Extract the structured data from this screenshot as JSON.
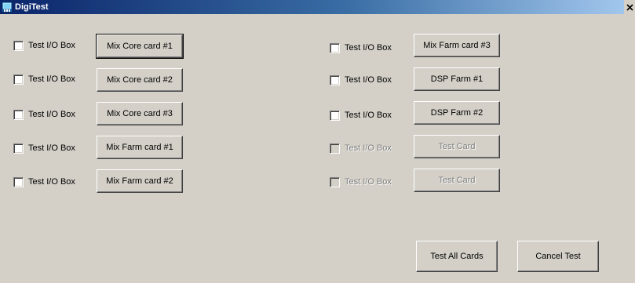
{
  "window": {
    "title": "DigiTest",
    "close_glyph": "✕"
  },
  "left_column": [
    {
      "checkbox_label": "Test I/O Box",
      "checked": false,
      "enabled": true,
      "button_label": "Mix Core card #1",
      "button_enabled": true
    },
    {
      "checkbox_label": "Test I/O Box",
      "checked": false,
      "enabled": true,
      "button_label": "Mix Core card #2",
      "button_enabled": true
    },
    {
      "checkbox_label": "Test I/O Box",
      "checked": false,
      "enabled": true,
      "button_label": "Mix Core card #3",
      "button_enabled": true
    },
    {
      "checkbox_label": "Test I/O Box",
      "checked": false,
      "enabled": true,
      "button_label": "Mix Farm card #1",
      "button_enabled": true
    },
    {
      "checkbox_label": "Test I/O Box",
      "checked": false,
      "enabled": true,
      "button_label": "Mix Farm card #2",
      "button_enabled": true
    }
  ],
  "right_column": [
    {
      "checkbox_label": "Test I/O Box",
      "checked": false,
      "enabled": true,
      "button_label": "Mix Farm card #3",
      "button_enabled": true
    },
    {
      "checkbox_label": "Test I/O Box",
      "checked": false,
      "enabled": true,
      "button_label": "DSP Farm #1",
      "button_enabled": true
    },
    {
      "checkbox_label": "Test I/O Box",
      "checked": false,
      "enabled": true,
      "button_label": "DSP Farm #2",
      "button_enabled": true
    },
    {
      "checkbox_label": "Test I/O Box",
      "checked": false,
      "enabled": false,
      "button_label": "Test Card",
      "button_enabled": false
    },
    {
      "checkbox_label": "Test I/O Box",
      "checked": false,
      "enabled": false,
      "button_label": "Test Card",
      "button_enabled": false
    }
  ],
  "actions": {
    "test_all_label": "Test All Cards",
    "cancel_label": "Cancel Test"
  },
  "colors": {
    "face": "#d4d0c8",
    "title_start": "#0a246a",
    "title_end": "#a6caf0",
    "disabled_text": "#808080"
  },
  "icons": {
    "app": "app-icon",
    "close": "close-icon"
  }
}
